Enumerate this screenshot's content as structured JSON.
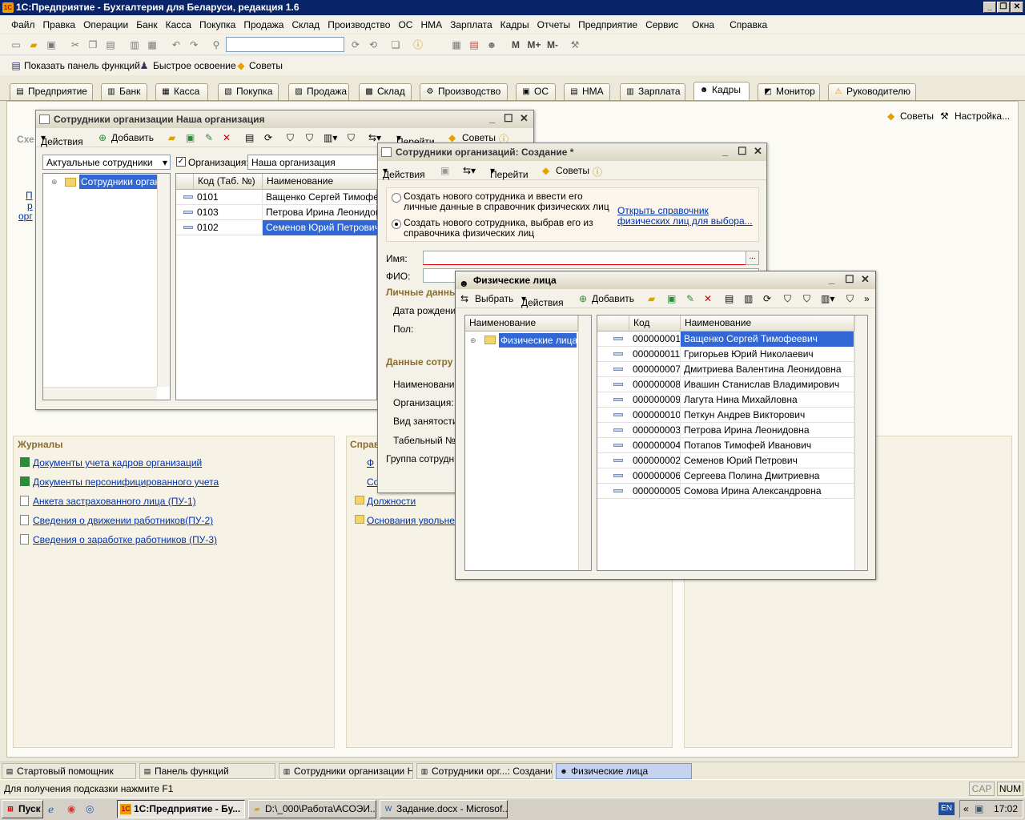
{
  "app": {
    "title": "1С:Предприятие - Бухгалтерия для Беларуси, редакция 1.6"
  },
  "menu": [
    "Файл",
    "Правка",
    "Операции",
    "Банк",
    "Касса",
    "Покупка",
    "Продажа",
    "Склад",
    "Производство",
    "ОС",
    "НМА",
    "Зарплата",
    "Кадры",
    "Отчеты",
    "Предприятие",
    "Сервис",
    "Окна",
    "Справка"
  ],
  "panel2": {
    "show_panel": "Показать панель функций",
    "quick": "Быстрое освоение",
    "tips": "Советы"
  },
  "tabs": [
    "Предприятие",
    "Банк",
    "Касса",
    "Покупка",
    "Продажа",
    "Склад",
    "Производство",
    "ОС",
    "НМА",
    "Зарплата",
    "Кадры",
    "Монитор",
    "Руководителю"
  ],
  "right_actions": {
    "tips": "Советы",
    "settings": "Настройка..."
  },
  "bg": {
    "scheme_partial": "Схе",
    "link_partial": [
      "П",
      "р",
      "орг"
    ],
    "journals_title": "Журналы",
    "journals": [
      "Документы учета кадров организаций",
      "Документы персонифицированного учета",
      "Анкета застрахованного лица (ПУ-1)",
      "Сведения о движении работников(ПУ-2)",
      "Сведения о заработке работников (ПУ-3)"
    ],
    "refs_title_partial": "Справ",
    "refs": [
      "Ф",
      "Со",
      "Должности",
      "Основания увольнен"
    ]
  },
  "win1": {
    "title": "Сотрудники организации Наша организация",
    "actions": "Действия",
    "add": "Добавить",
    "goto": "Перейти",
    "tips": "Советы",
    "filter_value": "Актуальные сотрудники",
    "org_label": "Организация:",
    "org_value": "Наша организация",
    "tree_item": "Сотрудники органи",
    "col_code": "Код (Таб. №)",
    "col_name": "Наименование",
    "rows": [
      {
        "code": "0101",
        "name": "Ващенко Сергей Тимофее"
      },
      {
        "code": "0103",
        "name": "Петрова Ирина Леонидовн"
      },
      {
        "code": "0102",
        "name": "Семенов Юрий Петрович"
      }
    ]
  },
  "win2": {
    "title": "Сотрудники организаций: Создание *",
    "actions": "Действия",
    "goto": "Перейти",
    "tips": "Советы",
    "radio1": "Создать нового сотрудника и ввести его личные данные в справочник физических лиц",
    "radio2": "Создать нового сотрудника, выбрав его из справочника физических лиц",
    "open_link": "Открыть справочник физических лиц для выбора...",
    "name_label": "Имя:",
    "fio_label": "ФИО:",
    "personal_title": "Личные данны",
    "birth_label": "Дата рождения",
    "sex_label": "Пол:",
    "emp_title": "Данные сотру",
    "f_name": "Наименование",
    "f_org": "Организация:",
    "f_kind": "Вид занятости:",
    "f_tab": "Табельный №:",
    "f_group": "Группа сотрудни"
  },
  "win3": {
    "title": "Физические лица",
    "select": "Выбрать",
    "actions": "Действия",
    "add": "Добавить",
    "tree_header": "Наименование",
    "tree_item": "Физические лица",
    "col_code": "Код",
    "col_name": "Наименование",
    "rows": [
      {
        "code": "000000001",
        "name": "Ващенко Сергей Тимофеевич"
      },
      {
        "code": "000000011",
        "name": "Григорьев Юрий Николаевич"
      },
      {
        "code": "000000007",
        "name": "Дмитриева Валентина Леонидовна"
      },
      {
        "code": "000000008",
        "name": "Ивашин Станислав Владимирович"
      },
      {
        "code": "000000009",
        "name": "Лагута Нина Михайловна"
      },
      {
        "code": "000000010",
        "name": "Петкун Андрев Викторович"
      },
      {
        "code": "000000003",
        "name": "Петрова Ирина Леонидовна"
      },
      {
        "code": "000000004",
        "name": "Потапов Тимофей Иванович"
      },
      {
        "code": "000000002",
        "name": "Семенов Юрий Петрович"
      },
      {
        "code": "000000006",
        "name": "Сергеева Полина Дмитриевна"
      },
      {
        "code": "000000005",
        "name": "Сомова Ирина Александровна"
      }
    ]
  },
  "taskbar": [
    "Стартовый помощник",
    "Панель функций",
    "Сотрудники организации Н...",
    "Сотрудники орг...: Создание *",
    "Физические лица"
  ],
  "status": {
    "hint": "Для получения подсказки нажмите F1",
    "cap": "CAP",
    "num": "NUM"
  },
  "os": {
    "start": "Пуск",
    "items": [
      "1С:Предприятие - Бу...",
      "D:\\_000\\Работа\\АСОЭИ...",
      "Задание.docx - Microsof..."
    ],
    "lang": "EN",
    "time": "17:02"
  }
}
